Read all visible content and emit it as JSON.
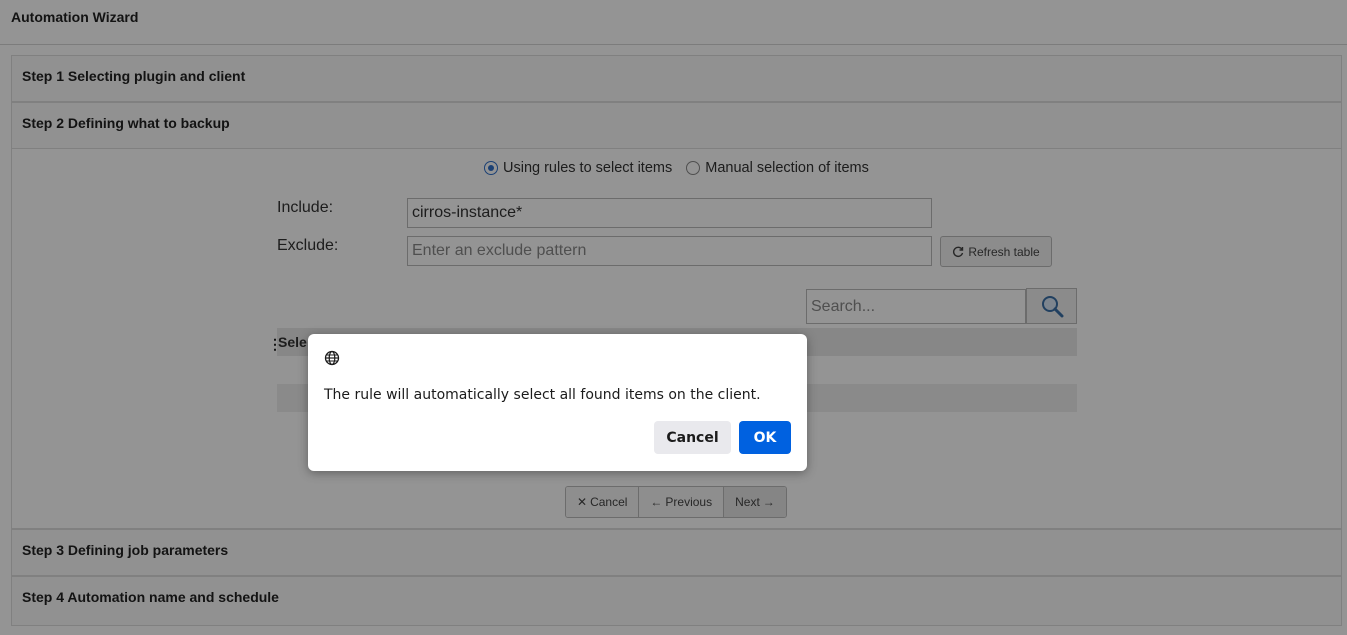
{
  "header": {
    "title": "Automation Wizard"
  },
  "steps": [
    {
      "label": "Step 1 Selecting plugin and client"
    },
    {
      "label": "Step 2 Defining what to backup"
    },
    {
      "label": "Step 3 Defining job parameters"
    },
    {
      "label": "Step 4 Automation name and schedule"
    }
  ],
  "selection_mode": {
    "rules_label": "Using rules to select items",
    "manual_label": "Manual selection of items",
    "selected": "rules"
  },
  "form": {
    "include_label": "Include:",
    "include_value": "cirros-instance*",
    "exclude_label": "Exclude:",
    "exclude_placeholder": "Enter an exclude pattern",
    "refresh_label": "Refresh table",
    "search_placeholder": "Search..."
  },
  "table": {
    "first_column_partial": "Sele"
  },
  "nav": {
    "cancel": "Cancel",
    "previous": "Previous",
    "next": "Next"
  },
  "dialog": {
    "message": "The rule will automatically select all found items on the client.",
    "cancel_label": "Cancel",
    "ok_label": "OK",
    "icon": "globe-icon"
  },
  "colors": {
    "dialog_ok": "#0061e0",
    "radio_accent": "#2f6fc9",
    "overlay": "rgba(0,0,0,0.42)"
  }
}
